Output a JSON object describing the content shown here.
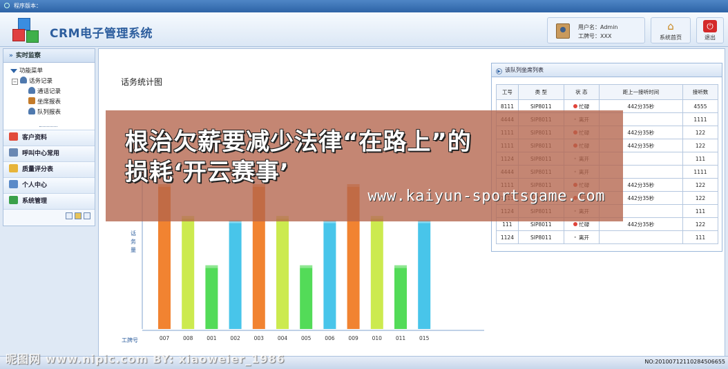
{
  "topbar": {
    "label": "程序版本："
  },
  "header": {
    "app_title": "CRM电子管理系统",
    "user_name": "用户名：Admin",
    "user_id": "工牌号：XXX",
    "home_label": "系统首页",
    "exit_label": "退出",
    "home_icon": "home-icon",
    "exit_icon": "power-icon"
  },
  "sidebar": {
    "section_title": "实时监察",
    "tree": {
      "root": "功能菜单",
      "group": "话务记录",
      "children": [
        "通话记录",
        "坐席报表",
        "队列报表"
      ]
    },
    "menu": [
      "客户资料",
      "呼叫中心常用",
      "质量评分表",
      "个人中心",
      "系统管理"
    ]
  },
  "main": {
    "chart_title": "话务统计图",
    "queue_title": "该队列坐席列表",
    "queue_columns": [
      "工号",
      "类 型",
      "状 态",
      "距上一接听时间",
      "接听数"
    ],
    "queue_rows": [
      [
        "8111",
        "SIP8011",
        "忙碌",
        "442分35秒",
        "4555"
      ],
      [
        "4444",
        "SIP8011",
        "离开",
        "",
        "1111"
      ],
      [
        "1111",
        "SIP8011",
        "忙碌",
        "442分35秒",
        "122"
      ],
      [
        "1111",
        "SIP8011",
        "忙碌",
        "442分35秒",
        "122"
      ],
      [
        "1124",
        "SIP8011",
        "离开",
        "",
        "111"
      ],
      [
        "4444",
        "SIP8011",
        "离开",
        "",
        "1111"
      ],
      [
        "1111",
        "SIP8011",
        "忙碌",
        "442分35秒",
        "122"
      ],
      [
        "1111",
        "SIP8011",
        "忙碌",
        "442分35秒",
        "122"
      ],
      [
        "1124",
        "SIP8011",
        "离开",
        "",
        "111"
      ],
      [
        "111",
        "SIP8011",
        "忙碌",
        "442分35秒",
        "122"
      ],
      [
        "1124",
        "SIP8011",
        "离开",
        "",
        "111"
      ]
    ]
  },
  "chart_data": {
    "type": "bar",
    "title": "话务统计图",
    "xlabel": "工牌号",
    "ylabel": "话务量",
    "categories": [
      "007",
      "008",
      "001",
      "002",
      "003",
      "004",
      "005",
      "006",
      "009",
      "010",
      "011",
      "015"
    ],
    "values": [
      100,
      78,
      44,
      75,
      100,
      78,
      44,
      75,
      100,
      78,
      44,
      75
    ],
    "colors": [
      "#f07820",
      "#c8e840",
      "#44d84a",
      "#38c0e8",
      "#f07820",
      "#c8e840",
      "#44d84a",
      "#38c0e8",
      "#f07820",
      "#c8e840",
      "#44d84a",
      "#38c0e8"
    ],
    "ylim": [
      0,
      100
    ],
    "grid": false
  },
  "overlay": {
    "line1": "根治欠薪要减少法律“在路上”的",
    "line2": "损耗‘开云赛事’",
    "url": "www.kaiyun-sportsgame.com"
  },
  "footer": {
    "watermark": "昵图网 www.nipic.com  BY: xiaoweier_1986",
    "serial": "NO:20100712110284506655"
  }
}
